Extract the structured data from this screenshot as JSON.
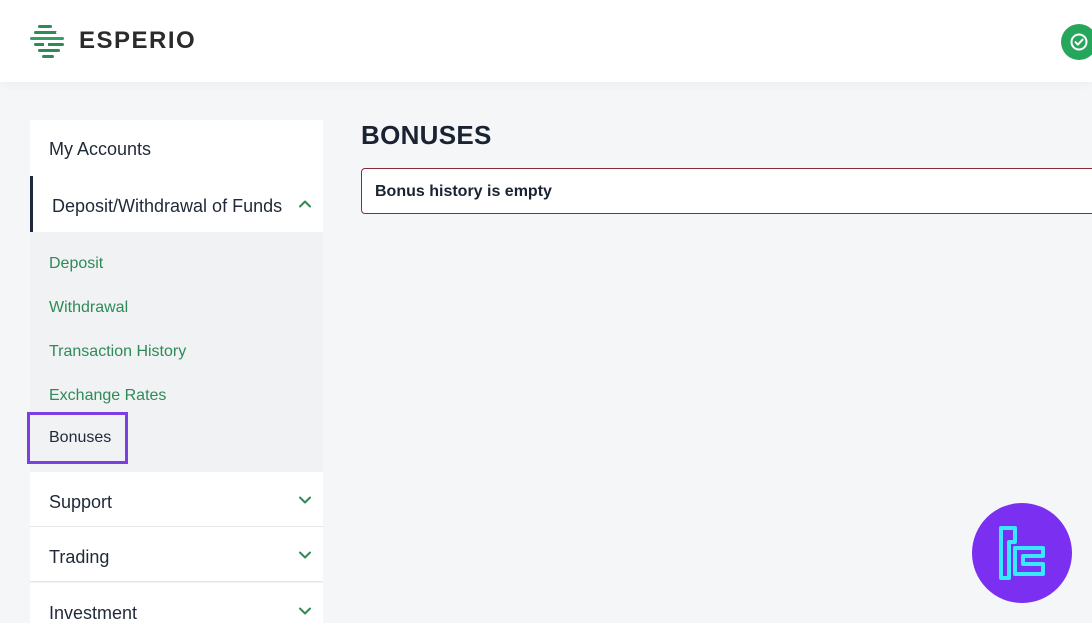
{
  "header": {
    "logo_text": "ESPERIO",
    "status_icon": "check-circle-icon"
  },
  "sidebar": {
    "my_accounts": "My Accounts",
    "funds_section": "Deposit/Withdrawal of Funds",
    "sub_items": [
      "Deposit",
      "Withdrawal",
      "Transaction History",
      "Exchange Rates",
      "Bonuses"
    ],
    "support": "Support",
    "trading": "Trading",
    "investment": "Investment"
  },
  "main": {
    "title": "BONUSES",
    "empty_message": "Bonus history is empty"
  },
  "colors": {
    "accent_green": "#2e8b57",
    "status_green": "#26a65b",
    "highlight_purple": "#7b3fe4",
    "alert_border": "#8a2a3a"
  }
}
